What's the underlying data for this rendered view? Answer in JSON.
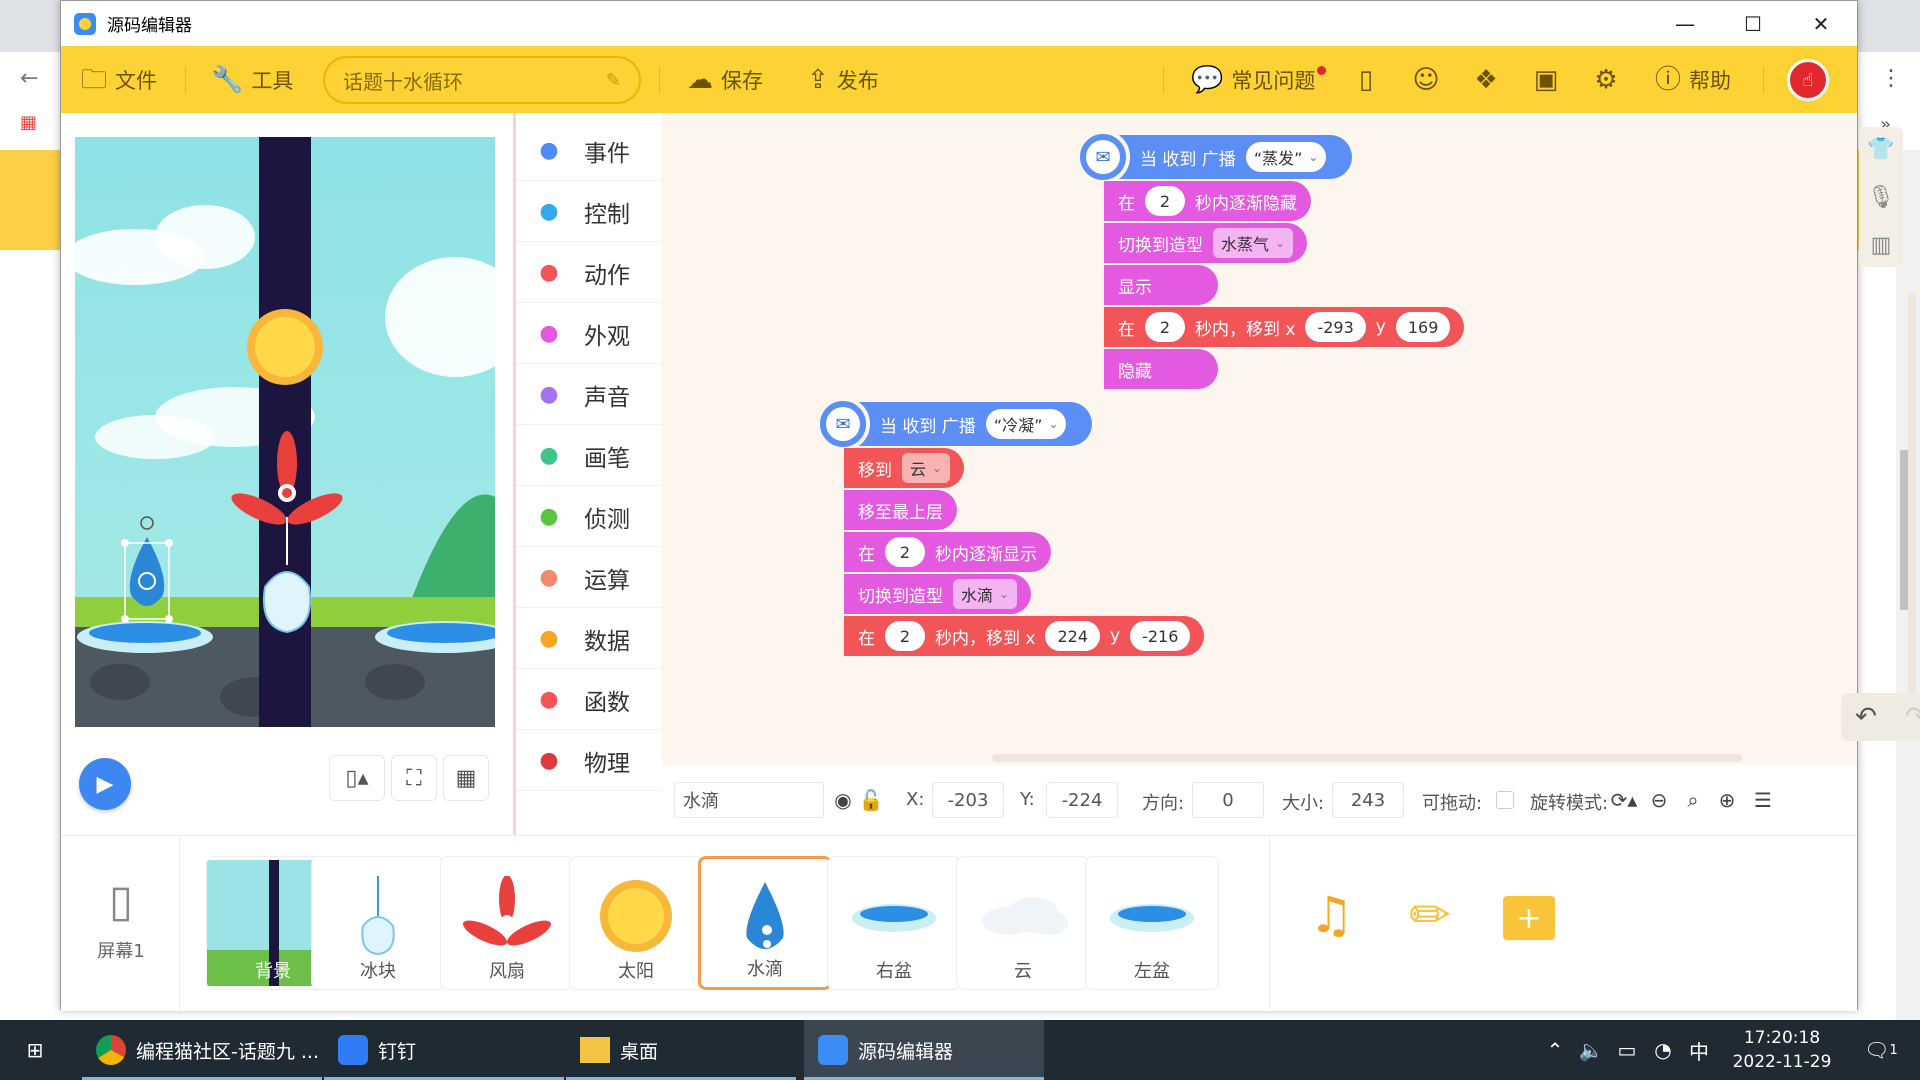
{
  "window": {
    "title": "源码编辑器"
  },
  "toolbar": {
    "file": "文件",
    "tools": "工具",
    "project_name": "话题十水循环",
    "save": "保存",
    "publish": "发布",
    "faq": "常见问题",
    "help": "帮助"
  },
  "categories": [
    {
      "label": "事件",
      "color": "#4f8cf7",
      "icon": "toggle-icon"
    },
    {
      "label": "控制",
      "color": "#35a9f0",
      "icon": "gamepad-icon"
    },
    {
      "label": "动作",
      "color": "#f15557",
      "icon": "ghost-icon"
    },
    {
      "label": "外观",
      "color": "#e35ae0",
      "icon": "shirt-icon"
    },
    {
      "label": "声音",
      "color": "#a374f2",
      "icon": "mic-icon"
    },
    {
      "label": "画笔",
      "color": "#3cc68c",
      "icon": "brush-icon"
    },
    {
      "label": "侦测",
      "color": "#5ac53f",
      "icon": "radar-icon"
    },
    {
      "label": "运算",
      "color": "#f28b6b",
      "icon": "calc-icon"
    },
    {
      "label": "数据",
      "color": "#f6a623",
      "icon": "chart-icon"
    },
    {
      "label": "函数",
      "color": "#f15557",
      "icon": "fx-icon"
    },
    {
      "label": "物理",
      "color": "#e03a3a",
      "icon": "magnet-icon"
    }
  ],
  "script1": {
    "hat": "当 收到 广播",
    "broadcast": "“蒸发”",
    "b1_pre": "在",
    "b1_val": "2",
    "b1_post": "秒内逐渐隐藏",
    "b2_pre": "切换到造型",
    "b2_val": "水蒸气",
    "b3": "显示",
    "b4_pre": "在",
    "b4_val": "2",
    "b4_mid": "秒内，移到 x",
    "b4_x": "-293",
    "b4_y_label": "y",
    "b4_y": "169",
    "b5": "隐藏"
  },
  "script2": {
    "hat": "当 收到 广播",
    "broadcast": "“冷凝”",
    "b1_pre": "移到",
    "b1_val": "云",
    "b2": "移至最上层",
    "b3_pre": "在",
    "b3_val": "2",
    "b3_post": "秒内逐渐显示",
    "b4_pre": "切换到造型",
    "b4_val": "水滴",
    "b5_pre": "在",
    "b5_val": "2",
    "b5_mid": "秒内，移到 x",
    "b5_x": "224",
    "b5_y_label": "y",
    "b5_y": "-216"
  },
  "props": {
    "name": "水滴",
    "x_label": "X:",
    "x": "-203",
    "y_label": "Y:",
    "y": "-224",
    "dir_label": "方向:",
    "dir": "0",
    "size_label": "大小:",
    "size": "243",
    "drag_label": "可拖动:",
    "rot_label": "旋转模式:"
  },
  "screen": {
    "label": "屏幕1"
  },
  "sprites": [
    {
      "name": "背景"
    },
    {
      "name": "冰块"
    },
    {
      "name": "风扇"
    },
    {
      "name": "太阳"
    },
    {
      "name": "水滴"
    },
    {
      "name": "右盆"
    },
    {
      "name": "云"
    },
    {
      "name": "左盆"
    }
  ],
  "taskbar": {
    "items": [
      "编程猫社区-话题九 ...",
      "钉钉",
      "桌面",
      "源码编辑器"
    ],
    "ime": "中",
    "time": "17:20:18",
    "date": "2022-11-29",
    "notif": "1"
  }
}
